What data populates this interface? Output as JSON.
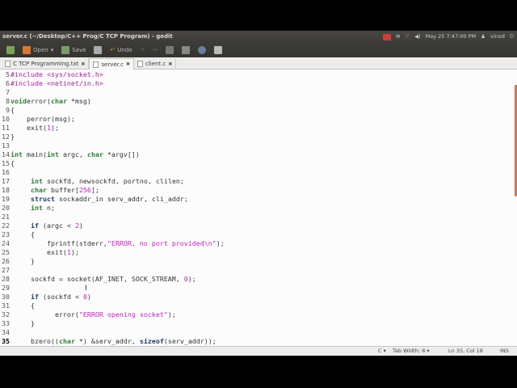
{
  "window": {
    "title": "server.c (~/Desktop/C++ Prog/C TCP Program) - gedit"
  },
  "tray": {
    "datetime": "May 25  7:47:00 PM",
    "user": "vinod"
  },
  "toolbar": {
    "open": "Open",
    "save": "Save",
    "undo": "Undo"
  },
  "tabs": [
    {
      "label": "C TCP Programming.txt"
    },
    {
      "label": "server.c"
    },
    {
      "label": "client.c"
    }
  ],
  "status": {
    "language": "C ▾",
    "tab_width": "Tab Width: 8 ▾",
    "position": "Ln 35, Col 18",
    "mode": "INS"
  },
  "code": {
    "current_line": 35,
    "lines": [
      {
        "n": "5",
        "t": [
          [
            "pp",
            "#include <sys/socket.h>"
          ]
        ]
      },
      {
        "n": "6",
        "t": [
          [
            "pp",
            "#include <netinet/in.h>"
          ]
        ]
      },
      {
        "n": "7",
        "t": []
      },
      {
        "n": "8",
        "t": [
          [
            "ty",
            "void"
          ],
          [
            "",
            "error("
          ],
          [
            "ty",
            "char"
          ],
          [
            "",
            " *msg)"
          ]
        ]
      },
      {
        "n": "9",
        "t": [
          [
            "",
            "{"
          ]
        ]
      },
      {
        "n": "10",
        "t": [
          [
            "",
            "    perror(msg);"
          ]
        ]
      },
      {
        "n": "11",
        "t": [
          [
            "",
            "    exit("
          ],
          [
            "num",
            "1"
          ],
          [
            "",
            ");"
          ]
        ]
      },
      {
        "n": "12",
        "t": [
          [
            "",
            "}"
          ]
        ]
      },
      {
        "n": "13",
        "t": []
      },
      {
        "n": "14",
        "t": [
          [
            "ty",
            "int"
          ],
          [
            "",
            " main("
          ],
          [
            "ty",
            "int"
          ],
          [
            "",
            " argc, "
          ],
          [
            "ty",
            "char"
          ],
          [
            "",
            " *argv[])"
          ]
        ]
      },
      {
        "n": "15",
        "t": [
          [
            "",
            "{"
          ]
        ]
      },
      {
        "n": "16",
        "t": []
      },
      {
        "n": "17",
        "t": [
          [
            "",
            "     "
          ],
          [
            "ty",
            "int"
          ],
          [
            "",
            " sockfd, newsockfd, portno, clilen;"
          ]
        ]
      },
      {
        "n": "18",
        "t": [
          [
            "",
            "     "
          ],
          [
            "ty",
            "char"
          ],
          [
            "",
            " buffer["
          ],
          [
            "num",
            "256"
          ],
          [
            "",
            "];"
          ]
        ]
      },
      {
        "n": "19",
        "t": [
          [
            "",
            "     "
          ],
          [
            "kw",
            "struct"
          ],
          [
            "",
            " sockaddr_in serv_addr, cli_addr;"
          ]
        ]
      },
      {
        "n": "20",
        "t": [
          [
            "",
            "     "
          ],
          [
            "ty",
            "int"
          ],
          [
            "",
            " n;"
          ]
        ]
      },
      {
        "n": "21",
        "t": []
      },
      {
        "n": "22",
        "t": [
          [
            "",
            "     "
          ],
          [
            "kw",
            "if"
          ],
          [
            "",
            " (argc < "
          ],
          [
            "num",
            "2"
          ],
          [
            "",
            ")"
          ]
        ]
      },
      {
        "n": "23",
        "t": [
          [
            "",
            "     {"
          ]
        ]
      },
      {
        "n": "24",
        "t": [
          [
            "",
            "         fprintf(stderr,"
          ],
          [
            "str",
            "\"ERROR, no port provided\\n\""
          ],
          [
            "",
            ");"
          ]
        ]
      },
      {
        "n": "25",
        "t": [
          [
            "",
            "         exit("
          ],
          [
            "num",
            "1"
          ],
          [
            "",
            ");"
          ]
        ]
      },
      {
        "n": "26",
        "t": [
          [
            "",
            "     }"
          ]
        ]
      },
      {
        "n": "27",
        "t": []
      },
      {
        "n": "28",
        "t": [
          [
            "",
            "     sockfd = socket(AF_INET, SOCK_STREAM, "
          ],
          [
            "num",
            "0"
          ],
          [
            "",
            ");"
          ]
        ]
      },
      {
        "n": "29",
        "t": []
      },
      {
        "n": "30",
        "t": [
          [
            "",
            "     "
          ],
          [
            "kw",
            "if"
          ],
          [
            "",
            " (sockfd < "
          ],
          [
            "num",
            "0"
          ],
          [
            "",
            ")"
          ]
        ]
      },
      {
        "n": "31",
        "t": [
          [
            "",
            "     {"
          ]
        ]
      },
      {
        "n": "32",
        "t": [
          [
            "",
            "           error("
          ],
          [
            "str",
            "\"ERROR opening socket\""
          ],
          [
            "",
            ");"
          ]
        ]
      },
      {
        "n": "33",
        "t": [
          [
            "",
            "     }"
          ]
        ]
      },
      {
        "n": "34",
        "t": []
      },
      {
        "n": "35",
        "t": [
          [
            "",
            "     bzero(("
          ],
          [
            "ty",
            "char"
          ],
          [
            "",
            " *) &serv_addr, "
          ],
          [
            "kw",
            "sizeof"
          ],
          [
            "",
            "(serv_addr));"
          ]
        ]
      }
    ]
  },
  "colors": {
    "accent": "#c87a5a",
    "keyword": "#1f3a68",
    "type": "#2e7d32",
    "literal": "#c020c0"
  }
}
